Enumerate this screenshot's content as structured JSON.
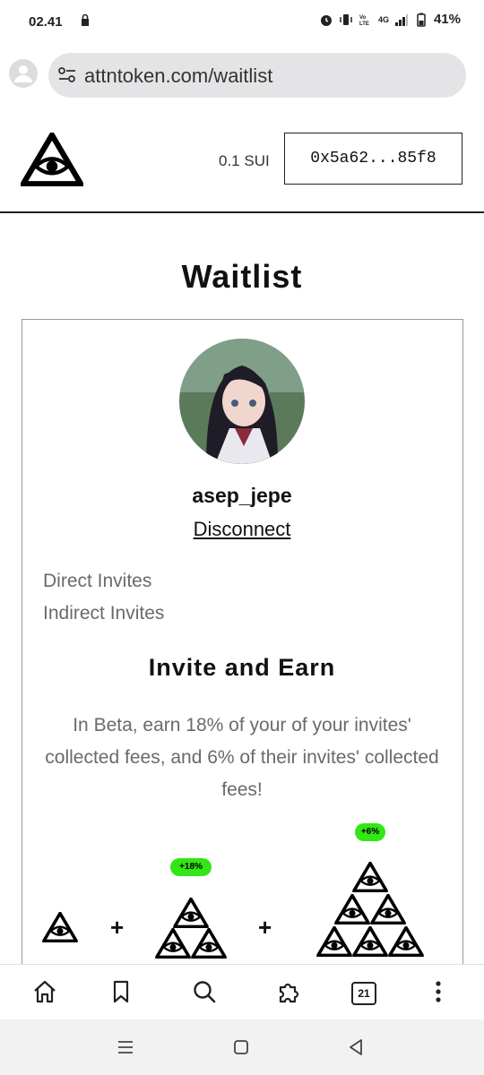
{
  "status_bar": {
    "time": "02.41",
    "battery": "41%",
    "network": "4G"
  },
  "browser": {
    "url": "attntoken.com/waitlist",
    "tab_count": "21"
  },
  "header": {
    "balance": "0.1 SUI",
    "wallet_address": "0x5a62...85f8"
  },
  "page": {
    "title": "Waitlist",
    "username": "asep_jepe",
    "disconnect_label": "Disconnect",
    "stats": [
      "Direct Invites",
      "Indirect Invites"
    ],
    "invite_title": "Invite and Earn",
    "invite_description": "In Beta, earn 18% of your of your invites' collected fees, and 6% of their invites' collected fees!",
    "badges": [
      "+18%",
      "+6%"
    ],
    "plus_sign": "+"
  },
  "colors": {
    "badge": "#33e616",
    "text": "#111111",
    "muted": "#6a6a6a"
  },
  "icons": [
    "home-icon",
    "bookmark-icon",
    "search-icon",
    "extensions-icon",
    "tabs-icon",
    "more-icon",
    "recents-icon",
    "home-nav-icon",
    "back-icon"
  ]
}
